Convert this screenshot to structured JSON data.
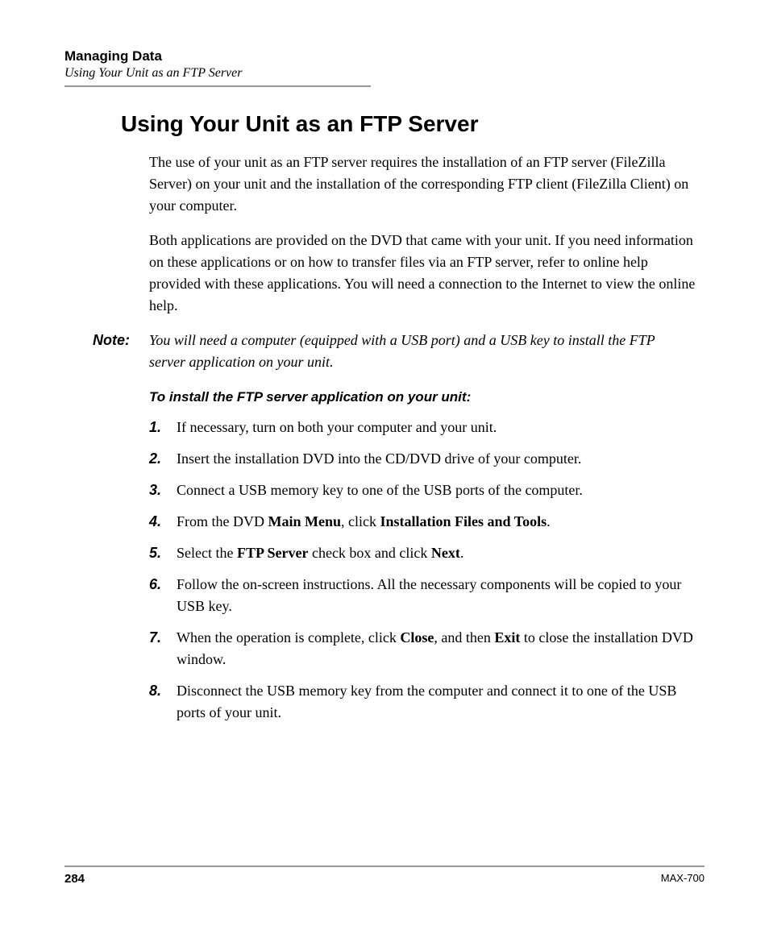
{
  "header": {
    "chapter": "Managing Data",
    "subsection": "Using Your Unit as an FTP Server"
  },
  "heading": "Using Your Unit as an FTP Server",
  "paragraphs": [
    "The use of your unit as an FTP server requires the installation of an FTP server (FileZilla Server) on your unit and the installation of the corresponding FTP client (FileZilla Client) on your computer.",
    "Both applications are provided on the DVD that came with your unit. If you need information on these applications or on how to transfer files via an FTP server, refer to online help provided with these applications. You will need a connection to the Internet to view the online help."
  ],
  "note": {
    "label": "Note:",
    "text": "You will need a computer (equipped with a USB port) and a USB key to install the FTP server application on your unit."
  },
  "instruct_heading": "To install the FTP server application on your unit:",
  "steps": [
    {
      "n": "1.",
      "plain": "If necessary, turn on both your computer and your unit."
    },
    {
      "n": "2.",
      "plain": "Insert the installation DVD into the CD/DVD drive of your computer."
    },
    {
      "n": "3.",
      "plain": "Connect a USB memory key to one of the USB ports of the computer."
    },
    {
      "n": "4.",
      "pre": "From the DVD ",
      "b1": "Main Menu",
      "mid": ", click ",
      "b2": "Installation Files and Tools",
      "post": "."
    },
    {
      "n": "5.",
      "pre": "Select the ",
      "b1": "FTP Server",
      "mid": " check box and click ",
      "b2": "Next",
      "post": "."
    },
    {
      "n": "6.",
      "plain": "Follow the on-screen instructions. All the necessary components will be copied to your USB key."
    },
    {
      "n": "7.",
      "pre": "When the operation is complete, click ",
      "b1": "Close",
      "mid": ", and then ",
      "b2": "Exit",
      "post": " to close the installation DVD window."
    },
    {
      "n": "8.",
      "plain": "Disconnect the USB memory key from the computer and connect it to one of the USB ports of your unit."
    }
  ],
  "footer": {
    "page": "284",
    "model": "MAX-700"
  }
}
